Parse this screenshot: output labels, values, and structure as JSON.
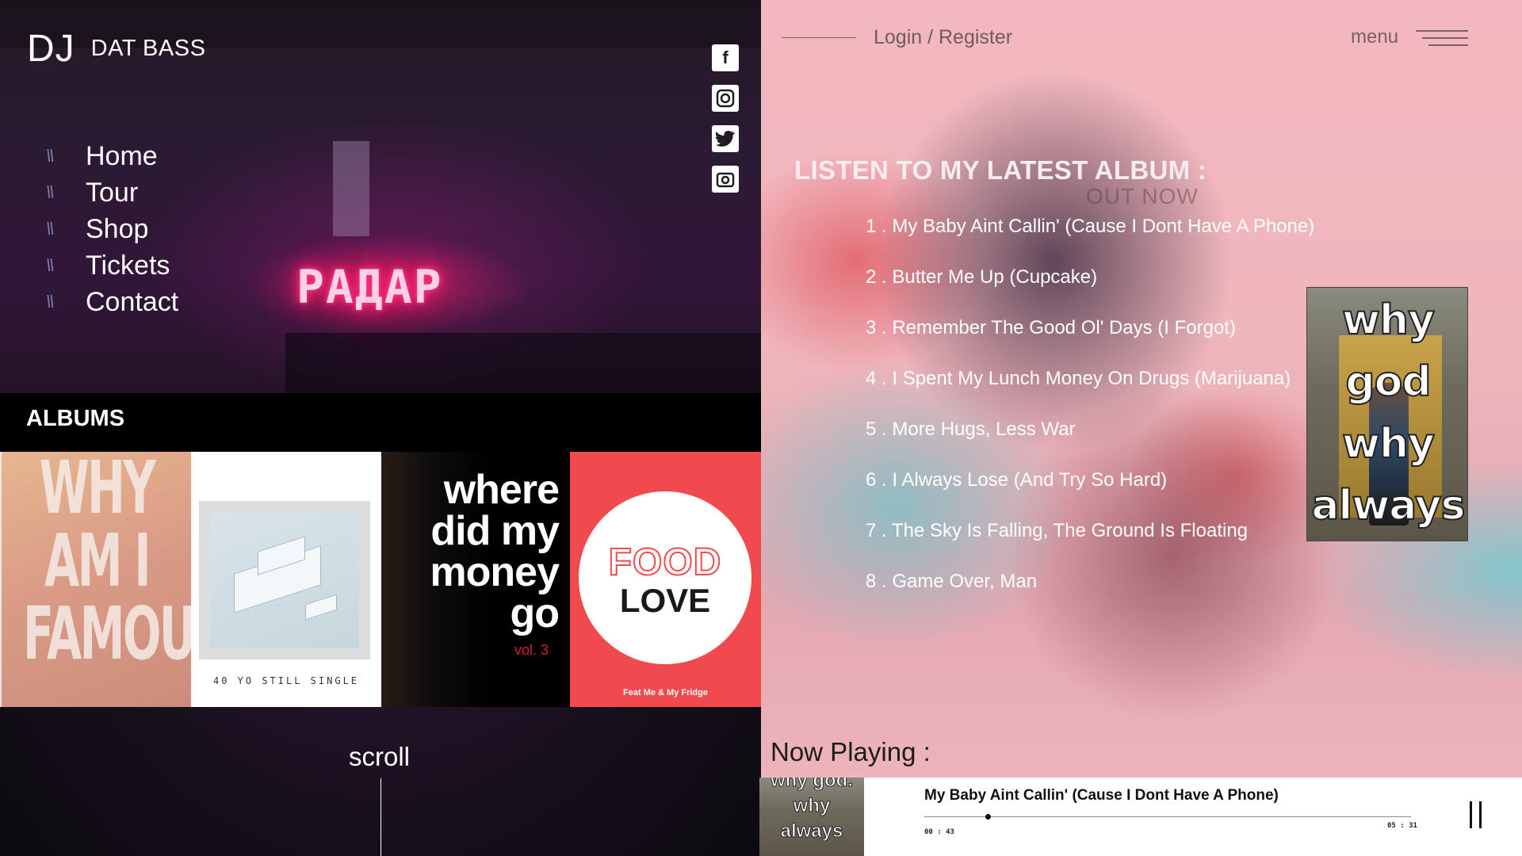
{
  "brand": {
    "dj": "DJ",
    "name": "DAT BASS"
  },
  "nav": [
    {
      "label": "Home"
    },
    {
      "label": "Tour"
    },
    {
      "label": "Shop"
    },
    {
      "label": "Tickets"
    },
    {
      "label": "Contact"
    }
  ],
  "social_icons": [
    "facebook-icon",
    "instagram-icon",
    "twitter-icon",
    "camera-icon"
  ],
  "hero": {
    "neon_sign": "РАДАР"
  },
  "albums": {
    "title": "ALBUMS",
    "items": [
      {
        "cover_text": "WHY AM I FAMOUS"
      },
      {
        "cover_text": "40 YO STILL SINGLE"
      },
      {
        "cover_text": "where did my money go",
        "subtitle": "vol. 3"
      },
      {
        "cover_text_1": "FOOD",
        "cover_text_2": "LOVE",
        "caption": "Feat Me & My Fridge"
      }
    ]
  },
  "scroll": {
    "label": "scroll"
  },
  "header": {
    "login": "Login / Register",
    "menu": "menu"
  },
  "latest_album": {
    "heading": "LISTEN TO MY LATEST ALBUM :",
    "status": "OUT NOW",
    "cover_text": "why god why always me",
    "tracks": [
      "1 . My Baby Aint Callin' (Cause I Dont Have A Phone)",
      "2 . Butter Me Up (Cupcake)",
      "3 . Remember The Good Ol' Days (I Forgot)",
      "4 . I Spent My Lunch Money On Drugs (Marijuana)",
      "5 . More Hugs, Less War",
      "6 . I Always Lose (And Try So Hard)",
      "7 . The Sky Is Falling, The Ground Is Floating",
      "8 . Game Over, Man"
    ]
  },
  "player": {
    "now_playing_label": "Now Playing :",
    "thumb_text": "why god. why always",
    "title": "My Baby Aint Callin' (Cause I Dont Have A Phone)",
    "current_time": "00 : 43",
    "total_time": "05 : 31",
    "progress_fraction": 0.13,
    "state": "playing"
  },
  "colors": {
    "accent_pink": "#ff2d7a",
    "right_bg": "#f0b9c0",
    "album_red": "#f04a4e"
  }
}
